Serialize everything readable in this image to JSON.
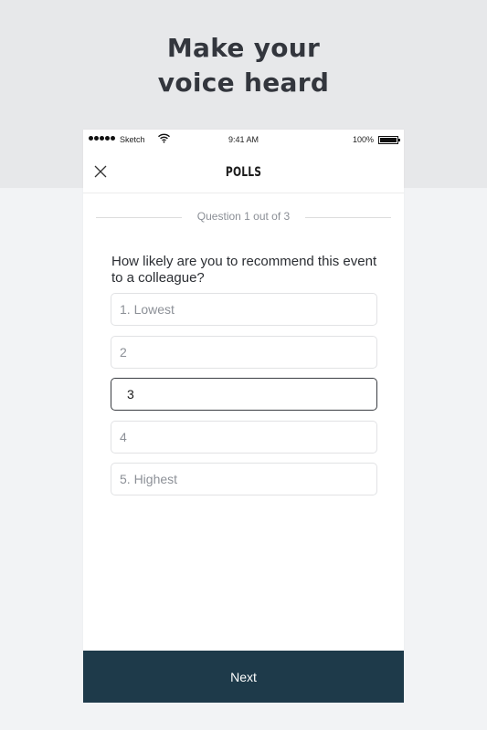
{
  "headline": {
    "line1": "Make your",
    "line2": "voice heard"
  },
  "status_bar": {
    "carrier": "Sketch",
    "time": "9:41 AM",
    "battery": "100%"
  },
  "nav": {
    "title": "POLLS",
    "close_icon": "close-icon"
  },
  "progress": {
    "label": "Question 1 out of 3"
  },
  "question": {
    "text": "How likely are you to recommend this event to a colleague?"
  },
  "options": [
    {
      "label": "1. Lowest",
      "selected": false
    },
    {
      "label": "2",
      "selected": false
    },
    {
      "label": "3",
      "selected": true
    },
    {
      "label": "4",
      "selected": false
    },
    {
      "label": "5. Highest",
      "selected": false
    }
  ],
  "footer": {
    "next_label": "Next"
  },
  "colors": {
    "accent": "#1e3a4a",
    "background": "#f2f3f5",
    "hero": "#e7e8ea"
  }
}
